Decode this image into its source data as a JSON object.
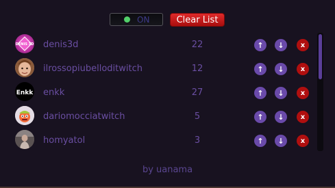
{
  "controls": {
    "toggle_label": "ON",
    "toggle_state": "on",
    "clear_label": "Clear List"
  },
  "rows": [
    {
      "name": "denis3d",
      "count": "22",
      "avatar": "avatar-denis3d-logo",
      "avatar_text": "DENIS 3D"
    },
    {
      "name": "ilrossopiubelloditwitch",
      "count": "12",
      "avatar": "avatar-face"
    },
    {
      "name": "enkk",
      "count": "27",
      "avatar": "avatar-enkk-text",
      "avatar_text": "Enkk"
    },
    {
      "name": "dariomocciatwitch",
      "count": "5",
      "avatar": "avatar-cartoon-face"
    },
    {
      "name": "homyatol",
      "count": "3",
      "avatar": "avatar-photo"
    }
  ],
  "row_buttons": {
    "up": "↑",
    "down": "↓",
    "remove": "x"
  },
  "footer": "by uanama",
  "colors": {
    "accent": "#6a4aaa",
    "danger": "#b00f0f",
    "text": "#6a4ea2",
    "background": "#181220",
    "on_indicator": "#52d06a"
  }
}
